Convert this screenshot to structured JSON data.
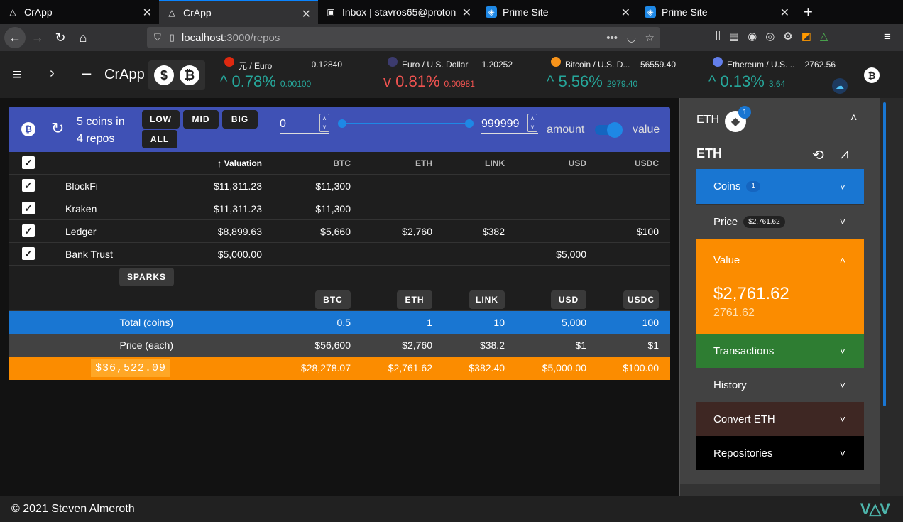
{
  "tabs": [
    {
      "label": "CrApp",
      "active": false
    },
    {
      "label": "CrApp",
      "active": true
    },
    {
      "label": "Inbox | stavros65@proton",
      "active": false
    },
    {
      "label": "Prime Site",
      "active": false
    },
    {
      "label": "Prime Site",
      "active": false
    }
  ],
  "url": {
    "host": "localhost",
    "path": ":3000/repos"
  },
  "app": {
    "title": "CrApp",
    "dollar_glyph": "$",
    "btc_glyph": "₿"
  },
  "tickers": [
    {
      "name": "元 / Euro",
      "price": "0.12840",
      "pct": "0.78%",
      "chg": "0.00100",
      "dir": "up",
      "arrow": "^"
    },
    {
      "name": "Euro / U.S. Dollar",
      "price": "1.20252",
      "pct": "0.81%",
      "chg": "0.00981",
      "dir": "down",
      "arrow": "v"
    },
    {
      "name": "Bitcoin / U.S. D...",
      "price": "56559.40",
      "pct": "5.56%",
      "chg": "2979.40",
      "dir": "up",
      "arrow": "^"
    },
    {
      "name": "Ethereum / U.S. ...",
      "price": "2762.56",
      "pct": "0.13%",
      "chg": "3.64",
      "dir": "up",
      "arrow": "^"
    }
  ],
  "toolbar": {
    "line1": "5 coins in",
    "line2": "4 repos",
    "buttons": [
      "LOW",
      "MID",
      "BIG",
      "ALL"
    ],
    "min": "0",
    "max": "999999",
    "toggle_left": "amount",
    "toggle_right": "value"
  },
  "table": {
    "headers": [
      "Valuation",
      "BTC",
      "ETH",
      "LINK",
      "USD",
      "USDC"
    ],
    "rows": [
      {
        "name": "BlockFi",
        "valuation": "$11,311.23",
        "btc": "$11,300",
        "eth": "",
        "link": "",
        "usd": "",
        "usdc": ""
      },
      {
        "name": "Kraken",
        "valuation": "$11,311.23",
        "btc": "$11,300",
        "eth": "",
        "link": "",
        "usd": "",
        "usdc": ""
      },
      {
        "name": "Ledger",
        "valuation": "$8,899.63",
        "btc": "$5,660",
        "eth": "$2,760",
        "link": "$382",
        "usd": "",
        "usdc": "$100"
      },
      {
        "name": "Bank Trust",
        "valuation": "$5,000.00",
        "btc": "",
        "eth": "",
        "link": "",
        "usd": "$5,000",
        "usdc": ""
      }
    ],
    "sparks": "SPARKS",
    "coin_buttons": [
      "BTC",
      "ETH",
      "LINK",
      "USD",
      "USDC"
    ],
    "total_label": "Total (coins)",
    "totals": [
      "0.5",
      "1",
      "10",
      "5,000",
      "100"
    ],
    "price_label": "Price (each)",
    "prices": [
      "$56,600",
      "$2,760",
      "$38.2",
      "$1",
      "$1"
    ],
    "grand_total": "$36,522.09",
    "values": [
      "$28,278.07",
      "$2,761.62",
      "$382.40",
      "$5,000.00",
      "$100.00"
    ]
  },
  "sidebar": {
    "symbol": "ETH",
    "badge": "1",
    "title": "ETH",
    "sections": [
      {
        "label": "Coins",
        "badge": "1",
        "color": "#1976d2"
      },
      {
        "label": "Price",
        "badge": "$2,761.62",
        "color": "#424242"
      },
      {
        "label": "Value",
        "color": "#fb8c00",
        "big": "$2,761.62",
        "small": "2761.62"
      },
      {
        "label": "Transactions",
        "color": "#2e7d32"
      },
      {
        "label": "History",
        "color": "#424242"
      },
      {
        "label": "Convert ETH",
        "color": "#3e2723"
      },
      {
        "label": "Repositories",
        "color": "#000000"
      }
    ]
  },
  "footer": {
    "text": "© 2021 Steven Almeroth"
  },
  "colors": {
    "primary": "#3f51b5",
    "accent": "#ff9800",
    "blue": "#1976d2"
  }
}
